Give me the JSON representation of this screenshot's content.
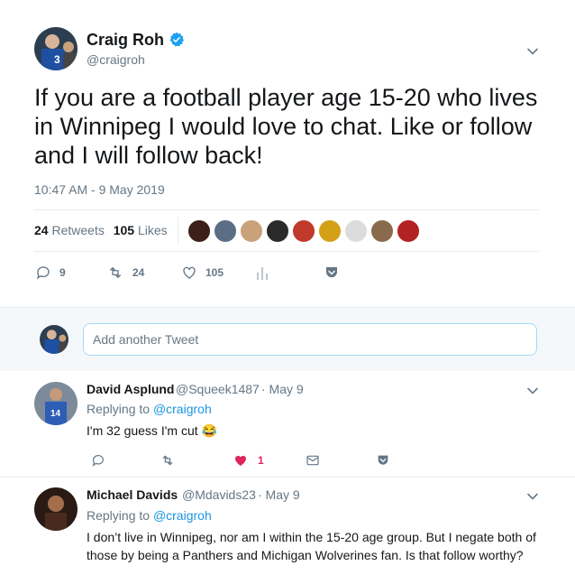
{
  "main_tweet": {
    "author_name": "Craig Roh",
    "author_handle": "@craigroh",
    "text": "If you are a football player age 15-20 who lives in Winnipeg I would love to chat. Like or follow and I will follow back!",
    "timestamp": "10:47 AM - 9 May 2019",
    "retweets_count": "24",
    "retweets_label": "Retweets",
    "likes_count": "105",
    "likes_label": "Likes",
    "actions": {
      "replies": "9",
      "retweets": "24",
      "likes": "105"
    },
    "liker_colors": [
      "#3b1f18",
      "#5b6e85",
      "#c9a27b",
      "#2a2a2a",
      "#c0392b",
      "#d4a017",
      "#dcdcdc",
      "#8a6a4c",
      "#b22222"
    ]
  },
  "compose": {
    "placeholder": "Add another Tweet"
  },
  "replies": [
    {
      "author_name": "David Asplund",
      "author_handle": "@Squeek1487",
      "date": "· May 9",
      "replying_prefix": "Replying to",
      "replying_to": "@craigroh",
      "text": "I'm 32 guess I'm cut 😂",
      "likes": "1"
    },
    {
      "author_name": "Michael Davids",
      "author_handle": "@Mdavids23",
      "date": "· May 9",
      "replying_prefix": "Replying to",
      "replying_to": "@craigroh",
      "text": "I don’t live in Winnipeg, nor am I within the 15-20 age group. But I negate both of those by being a Panthers and Michigan Wolverines fan. Is that follow worthy?"
    }
  ],
  "colors": {
    "accent": "#1da1f2",
    "link": "#1b95e0",
    "like": "#e0245e",
    "muted": "#657786"
  }
}
